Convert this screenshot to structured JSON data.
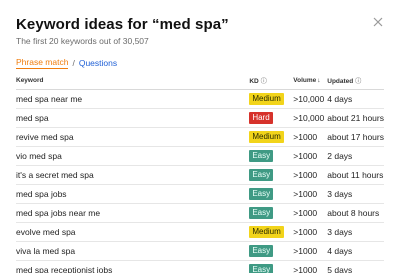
{
  "header": {
    "title": "Keyword ideas for “med spa”",
    "subtitle": "The first 20 keywords out of 30,507"
  },
  "tabs": {
    "active": "Phrase match",
    "separator": "/",
    "other": "Questions"
  },
  "table": {
    "columns": {
      "keyword": "Keyword",
      "kd": "KD",
      "volume": "Volume",
      "updated": "Updated"
    },
    "rows": [
      {
        "keyword": "med spa near me",
        "kd": "Medium",
        "kd_level": "medium",
        "volume": ">10,000",
        "updated": "4 days"
      },
      {
        "keyword": "med spa",
        "kd": "Hard",
        "kd_level": "hard",
        "volume": ">10,000",
        "updated": "about 21 hours"
      },
      {
        "keyword": "revive med spa",
        "kd": "Medium",
        "kd_level": "medium",
        "volume": ">1000",
        "updated": "about 17 hours"
      },
      {
        "keyword": "vio med spa",
        "kd": "Easy",
        "kd_level": "easy",
        "volume": ">1000",
        "updated": "2 days"
      },
      {
        "keyword": "it's a secret med spa",
        "kd": "Easy",
        "kd_level": "easy",
        "volume": ">1000",
        "updated": "about 11 hours"
      },
      {
        "keyword": "med spa jobs",
        "kd": "Easy",
        "kd_level": "easy",
        "volume": ">1000",
        "updated": "3 days"
      },
      {
        "keyword": "med spa jobs near me",
        "kd": "Easy",
        "kd_level": "easy",
        "volume": ">1000",
        "updated": "about 8 hours"
      },
      {
        "keyword": "evolve med spa",
        "kd": "Medium",
        "kd_level": "medium",
        "volume": ">1000",
        "updated": "3 days"
      },
      {
        "keyword": "viva la med spa",
        "kd": "Easy",
        "kd_level": "easy",
        "volume": ">1000",
        "updated": "4 days"
      },
      {
        "keyword": "med spa receptionist jobs",
        "kd": "Easy",
        "kd_level": "easy",
        "volume": ">1000",
        "updated": "5 days"
      }
    ]
  },
  "colors": {
    "accent_tab": "#f07d0d",
    "link": "#1e5fd6",
    "kd_medium": "#f2d41a",
    "kd_hard": "#d6322b",
    "kd_easy": "#3f9a84"
  },
  "icons": {
    "close": "close-icon",
    "info": "info-icon",
    "sort": "sort-desc-icon"
  }
}
